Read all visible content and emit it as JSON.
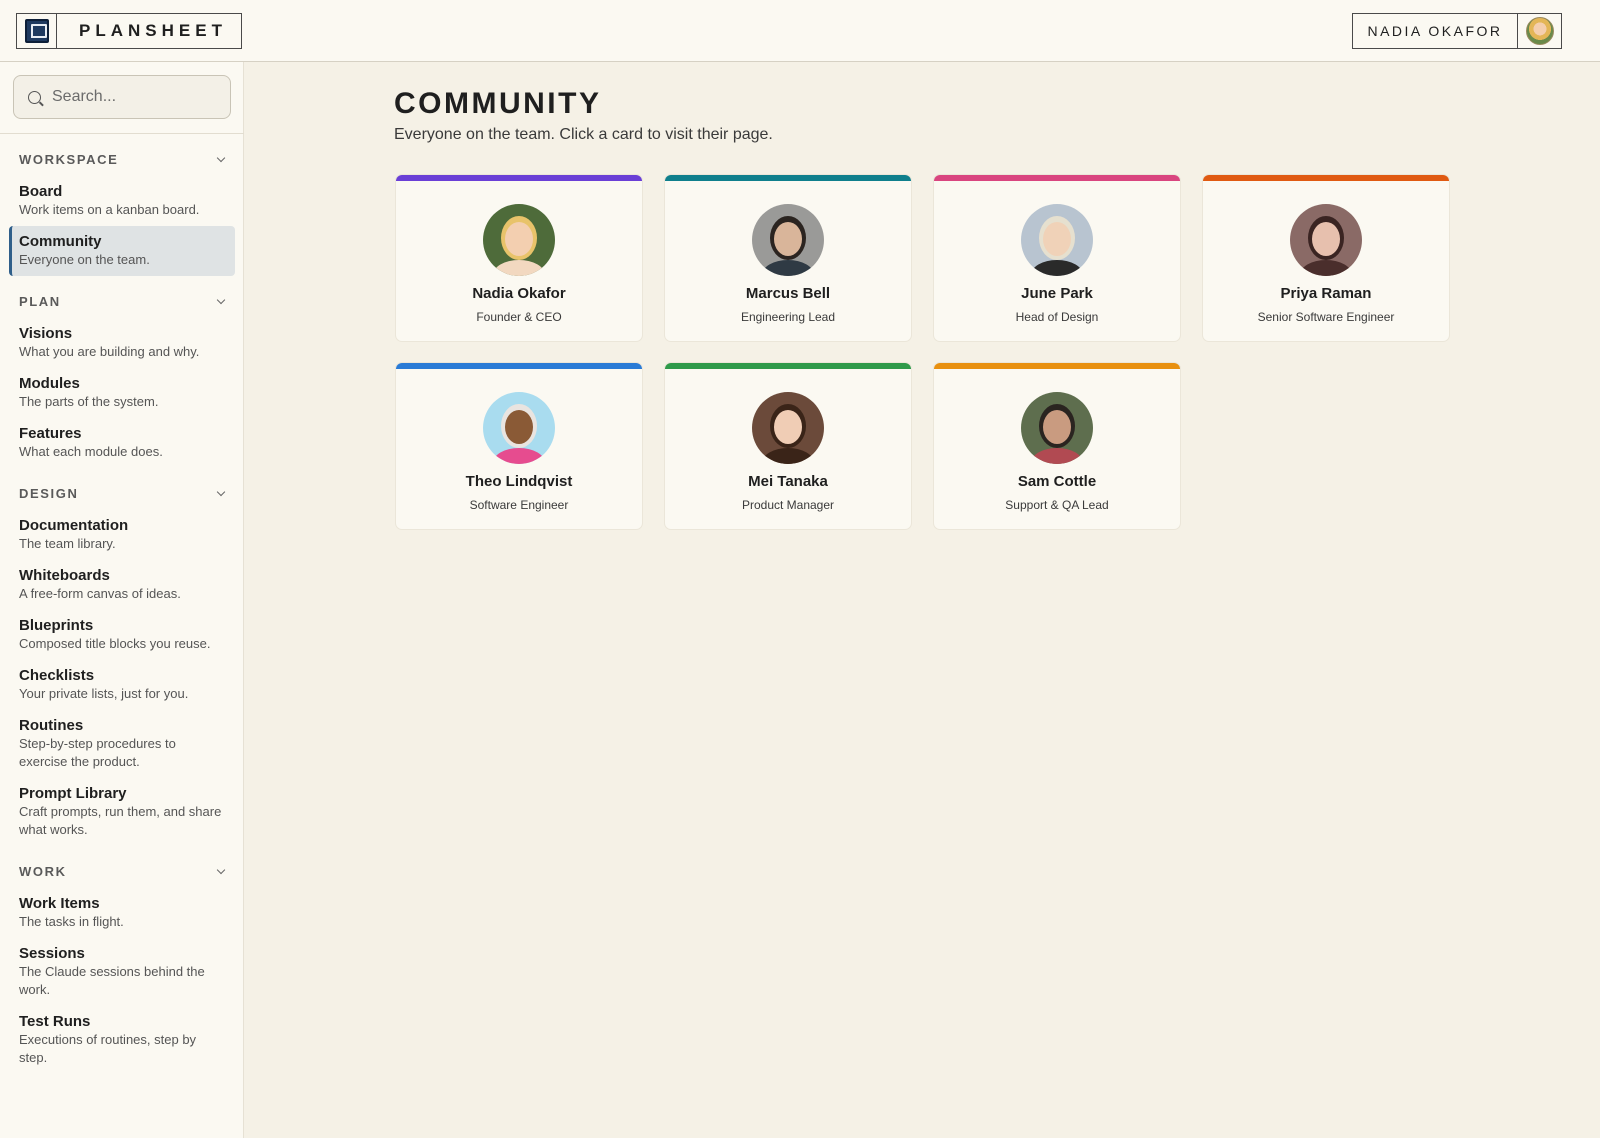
{
  "app": {
    "brand_name": "PLANSHEET",
    "user_name": "NADIA OKAFOR"
  },
  "search": {
    "placeholder": "Search..."
  },
  "sidebar": {
    "sections": [
      {
        "title": "WORKSPACE",
        "items": [
          {
            "label": "Board",
            "desc": "Work items on a kanban board."
          },
          {
            "label": "Community",
            "desc": "Everyone on the team.",
            "active": true
          }
        ]
      },
      {
        "title": "PLAN",
        "items": [
          {
            "label": "Visions",
            "desc": "What you are building and why."
          },
          {
            "label": "Modules",
            "desc": "The parts of the system."
          },
          {
            "label": "Features",
            "desc": "What each module does."
          }
        ]
      },
      {
        "title": "DESIGN",
        "items": [
          {
            "label": "Documentation",
            "desc": "The team library."
          },
          {
            "label": "Whiteboards",
            "desc": "A free-form canvas of ideas."
          },
          {
            "label": "Blueprints",
            "desc": "Composed title blocks you reuse."
          },
          {
            "label": "Checklists",
            "desc": "Your private lists, just for you."
          },
          {
            "label": "Routines",
            "desc": "Step-by-step procedures to exercise the product."
          },
          {
            "label": "Prompt Library",
            "desc": "Craft prompts, run them, and share what works."
          }
        ]
      },
      {
        "title": "WORK",
        "items": [
          {
            "label": "Work Items",
            "desc": "The tasks in flight."
          },
          {
            "label": "Sessions",
            "desc": "The Claude sessions behind the work."
          },
          {
            "label": "Test Runs",
            "desc": "Executions of routines, step by step."
          }
        ]
      }
    ]
  },
  "main": {
    "title": "COMMUNITY",
    "subtitle": "Everyone on the team. Click a card to visit their page."
  },
  "members": [
    {
      "name": "Nadia Okafor",
      "role": "Founder & CEO",
      "accent": "#6a3fd6",
      "bg": "#4e6b3a",
      "face": "#f3cfb0",
      "hair": "#e8c36a",
      "body": "#f2d8c0"
    },
    {
      "name": "Marcus Bell",
      "role": "Engineering Lead",
      "accent": "#0f7f8c",
      "bg": "#9a9a98",
      "face": "#d9b59a",
      "hair": "#2b2420",
      "body": "#2f3a44"
    },
    {
      "name": "June Park",
      "role": "Head of Design",
      "accent": "#d9457f",
      "bg": "#b8c4d0",
      "face": "#f0d2b8",
      "hair": "#e6e0cf",
      "body": "#2a2a2a"
    },
    {
      "name": "Priya Raman",
      "role": "Senior Software Engineer",
      "accent": "#e05a12",
      "bg": "#8a6a66",
      "face": "#e7c0ae",
      "hair": "#3a2422",
      "body": "#4a2e2c"
    },
    {
      "name": "Theo Lindqvist",
      "role": "Software Engineer",
      "accent": "#2a7bd6",
      "bg": "#a9dcef",
      "face": "#8a5a36",
      "hair": "#e9e4e0",
      "body": "#e64c8f"
    },
    {
      "name": "Mei Tanaka",
      "role": "Product Manager",
      "accent": "#2f9a4a",
      "bg": "#6b4a3a",
      "face": "#f0cdb5",
      "hair": "#3a2418",
      "body": "#3a2418"
    },
    {
      "name": "Sam Cottle",
      "role": "Support & QA Lead",
      "accent": "#e8900f",
      "bg": "#5e6e4e",
      "face": "#c99b80",
      "hair": "#2a2420",
      "body": "#b14a52"
    }
  ]
}
